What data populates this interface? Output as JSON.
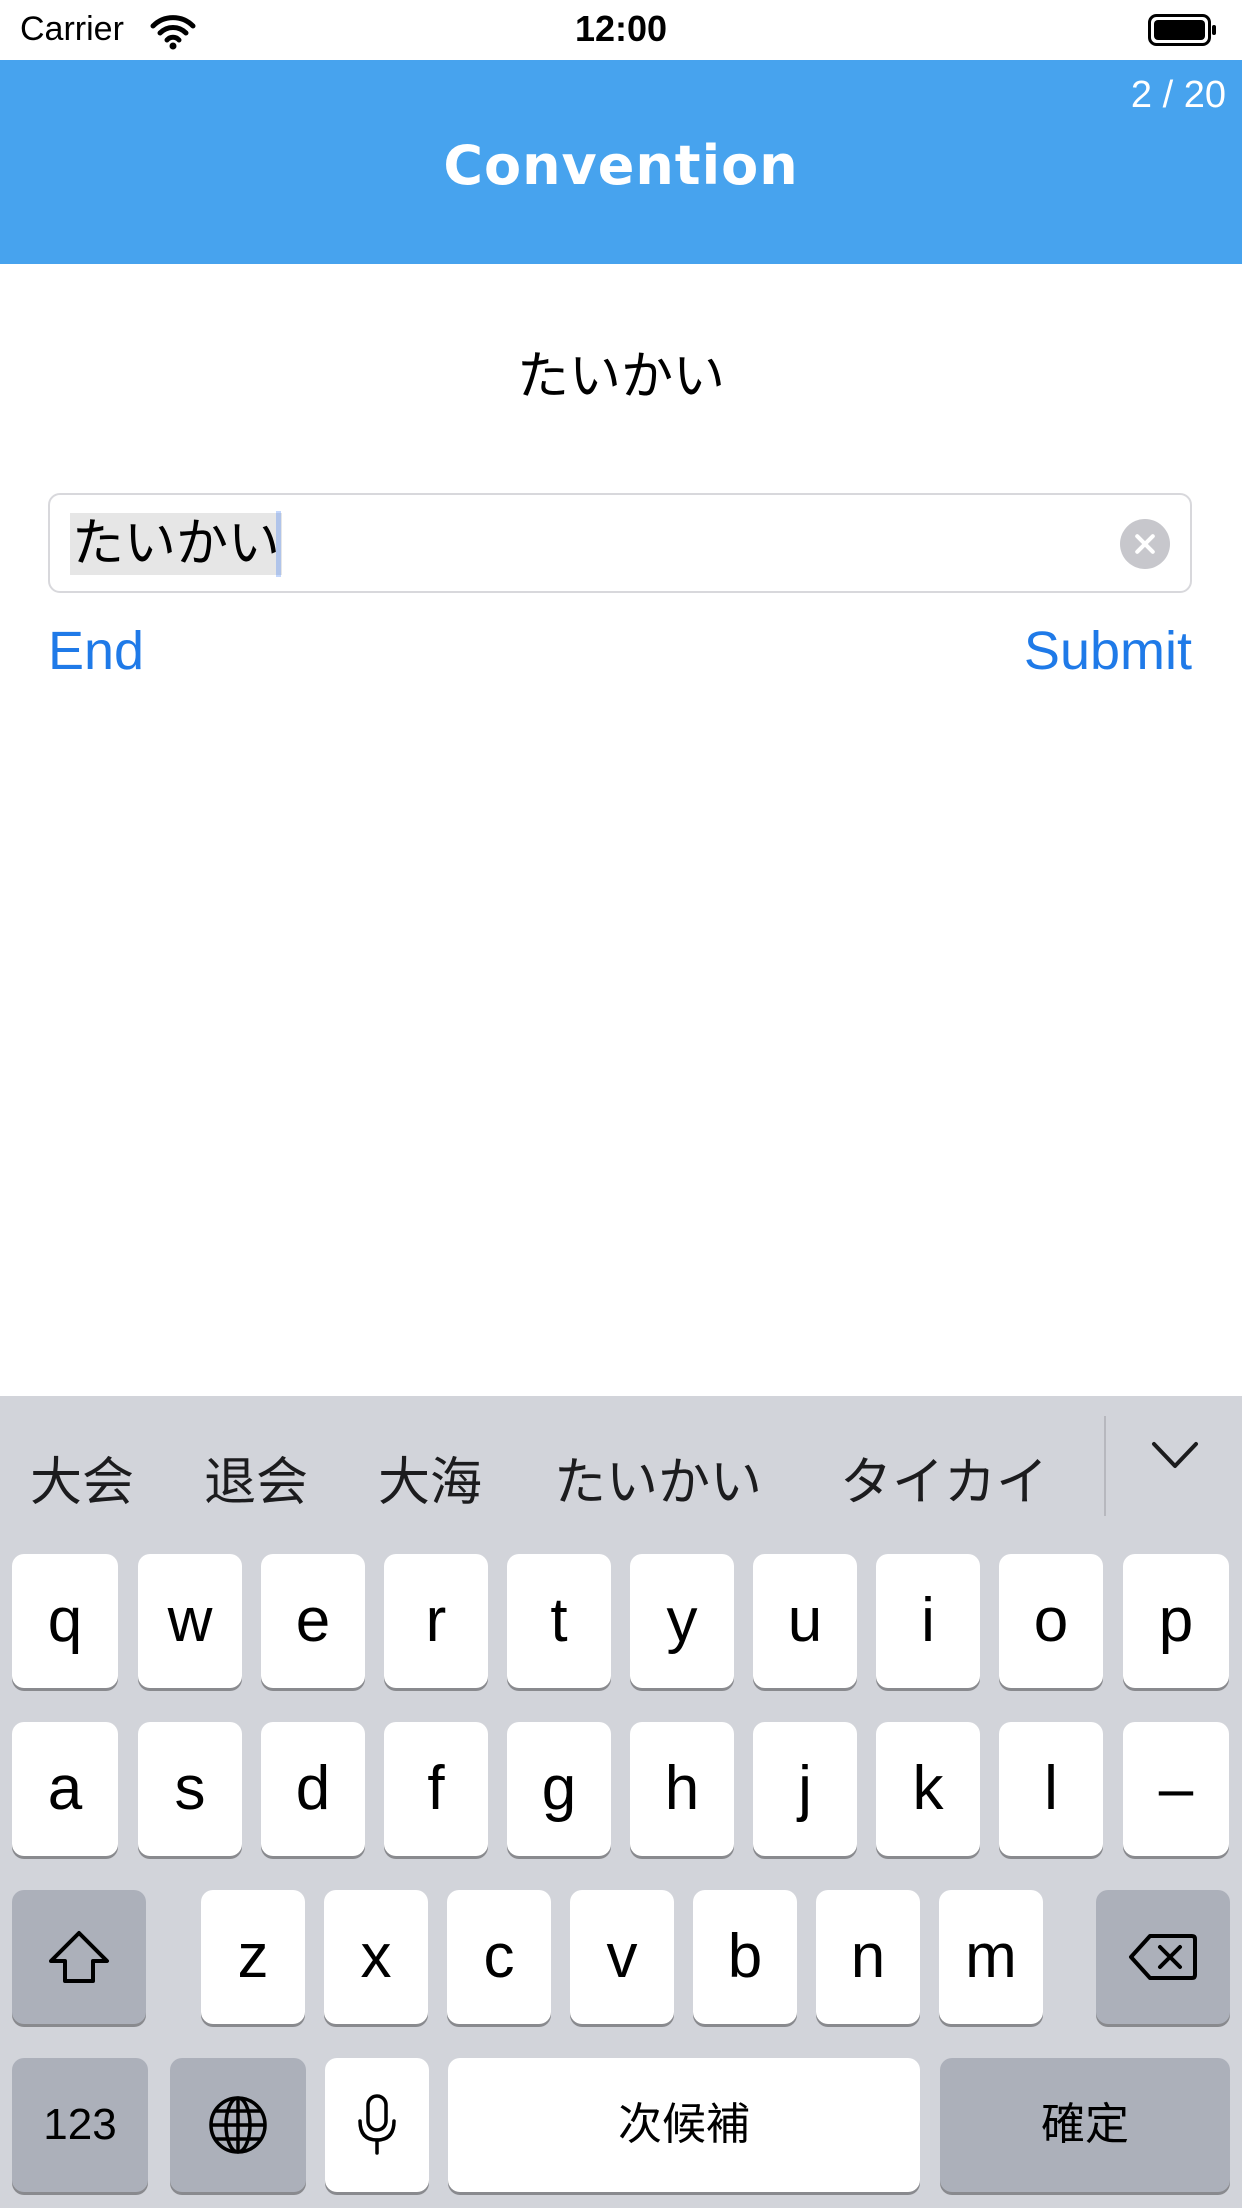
{
  "status_bar": {
    "carrier": "Carrier",
    "time": "12:00"
  },
  "nav": {
    "title": "Convention",
    "counter": "2 / 20"
  },
  "prompt": {
    "reading": "たいかい"
  },
  "answer_field": {
    "value": "たいかい"
  },
  "actions": {
    "end_label": "End",
    "submit_label": "Submit"
  },
  "keyboard": {
    "candidates": [
      "大会",
      "退会",
      "大海",
      "たいかい",
      "タイカイ"
    ],
    "row1": [
      "q",
      "w",
      "e",
      "r",
      "t",
      "y",
      "u",
      "i",
      "o",
      "p"
    ],
    "row2": [
      "a",
      "s",
      "d",
      "f",
      "g",
      "h",
      "j",
      "k",
      "l",
      "–"
    ],
    "row3": [
      "z",
      "x",
      "c",
      "v",
      "b",
      "n",
      "m"
    ],
    "numbers_label": "123",
    "space_label": "次候補",
    "confirm_label": "確定"
  },
  "colors": {
    "nav_bg": "#47a3ee",
    "accent": "#1f7ae8",
    "keyboard_bg": "#d2d4da"
  }
}
